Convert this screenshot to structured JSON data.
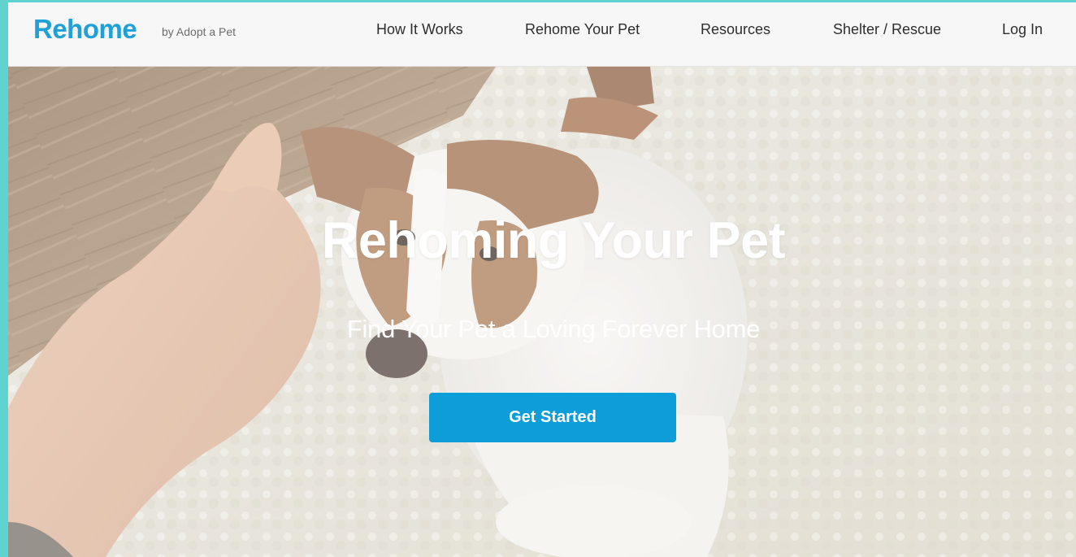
{
  "header": {
    "logo": "Rehome",
    "logo_sub": "by Adopt a Pet",
    "nav": [
      {
        "label": "How It Works"
      },
      {
        "label": "Rehome Your Pet"
      },
      {
        "label": "Resources"
      },
      {
        "label": "Shelter / Rescue"
      },
      {
        "label": "Log In"
      }
    ]
  },
  "hero": {
    "title": "Rehoming Your Pet",
    "subtitle": "Find Your Pet a Loving Forever Home",
    "cta_label": "Get Started"
  },
  "colors": {
    "brand": "#1fa0d6",
    "button": "#0d9dd9",
    "header_bg": "#f7f7f7",
    "outer_border": "#5fd3d0"
  }
}
